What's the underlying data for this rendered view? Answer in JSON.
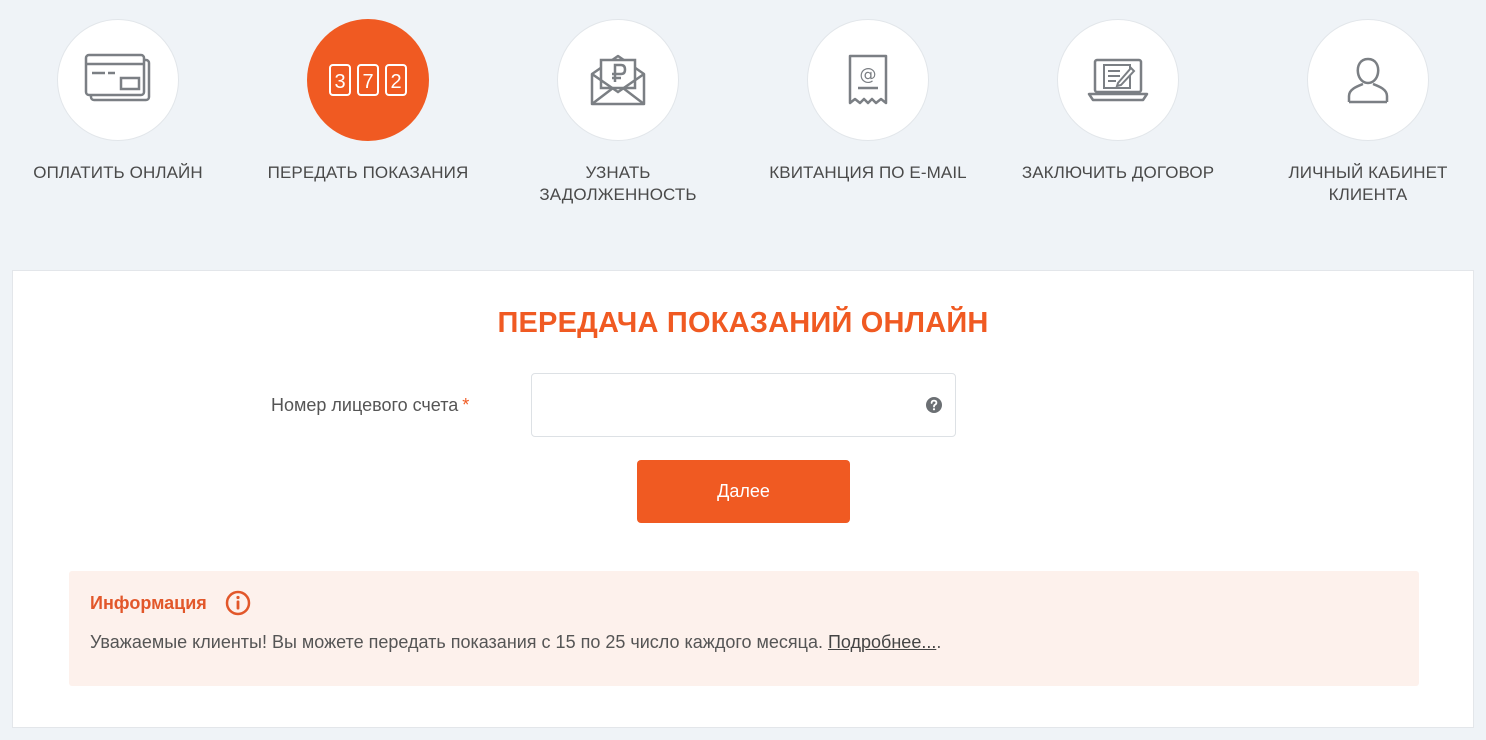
{
  "services": [
    {
      "label": "ОПЛАТИТЬ ОНЛАЙН",
      "icon": "card-icon",
      "active": false
    },
    {
      "label": "ПЕРЕДАТЬ ПОКАЗАНИЯ",
      "icon": "meter-icon",
      "active": true
    },
    {
      "label": "УЗНАТЬ ЗАДОЛЖЕННОСТЬ",
      "icon": "ruble-envelope-icon",
      "active": false
    },
    {
      "label": "КВИТАНЦИЯ ПО E-MAIL",
      "icon": "email-receipt-icon",
      "active": false
    },
    {
      "label": "ЗАКЛЮЧИТЬ ДОГОВОР",
      "icon": "laptop-contract-icon",
      "active": false
    },
    {
      "label": "ЛИЧНЫЙ КАБИНЕТ КЛИЕНТА",
      "icon": "user-icon",
      "active": false
    }
  ],
  "meter_digits": [
    "3",
    "7",
    "2"
  ],
  "form": {
    "title": "ПЕРЕДАЧА ПОКАЗАНИЙ ОНЛАЙН",
    "account_label": "Номер лицевого счета",
    "required_mark": "*",
    "account_value": "",
    "submit_label": "Далее"
  },
  "info": {
    "title": "Информация",
    "text": "Уважаемые клиенты! Вы можете передать показания с 15 по 25 число каждого месяца. ",
    "link": "Подробнее...",
    "after_link": "."
  },
  "colors": {
    "accent": "#f05a22",
    "background": "#eff3f7",
    "info_bg": "#fdf1ec",
    "icon_gray": "#7b7f84"
  }
}
